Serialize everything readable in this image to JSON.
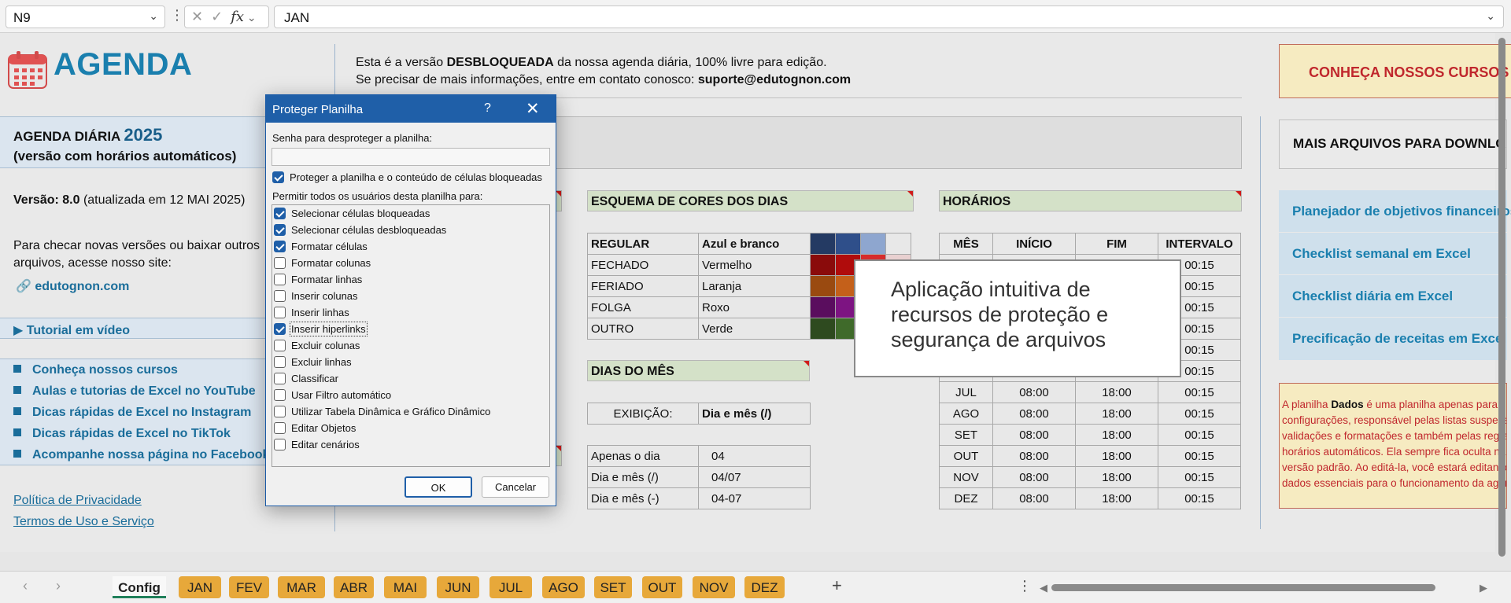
{
  "formula_bar": {
    "name_box": "N9",
    "formula": "JAN",
    "fx": "fx"
  },
  "header": {
    "title": "AGENDA",
    "info_line1_pre": "Esta é a versão ",
    "info_line1_bold": "DESBLOQUEADA",
    "info_line1_post": " da nossa agenda diária, 100% livre para edição.",
    "info_line2_pre": "Se precisar de mais informações, entre em contato conosco: ",
    "info_line2_email": "suporte@edutognon.com",
    "cursos_button": "CONHEÇA NOSSOS CURSOS"
  },
  "left_panel": {
    "title_line1": "AGENDA DIÁRIA",
    "year": "2025",
    "title_line2": "(versão com horários automáticos)",
    "versao_bold": "Versão: 8.0",
    "versao_rest": " (atualizada em 12 MAI 2025)",
    "checar": "Para checar novas versões ou baixar outros arquivos, acesse nosso site:",
    "site": "edutognon.com",
    "tutorial": "Tutorial em vídeo",
    "links": [
      "Conheça nossos cursos",
      "Aulas e tutorias de Excel no YouTube",
      "Dicas rápidas de Excel no Instagram",
      "Dicas rápidas de Excel no TikTok",
      "Acompanhe nossa página no Facebook"
    ],
    "privacy": "Política de Privacidade",
    "terms": "Termos de Uso e Serviço"
  },
  "cores": {
    "title": "ESQUEMA DE CORES DOS DIAS",
    "rows": [
      {
        "tipo": "REGULAR",
        "cor": "Azul e branco",
        "swatches": [
          "#243a63",
          "#2f4f8a",
          "#8ea6cf",
          "#e8e8e8"
        ]
      },
      {
        "tipo": "FECHADO",
        "cor": "Vermelho",
        "swatches": [
          "#8a0b0b",
          "#b00c0c",
          "#d62c2c",
          "#e8d0d0"
        ]
      },
      {
        "tipo": "FERIADO",
        "cor": "Laranja",
        "swatches": [
          "#9a4a10",
          "#c4601a",
          "#e28a3c",
          "#ecd8c4"
        ]
      },
      {
        "tipo": "FOLGA",
        "cor": "Roxo",
        "swatches": [
          "#5a0d5e",
          "#7d1482",
          "#a84aac",
          "#e2cfe3"
        ]
      },
      {
        "tipo": "OUTRO",
        "cor": "Verde",
        "swatches": [
          "#2e4a1f",
          "#3f6a2a",
          "#6f9a56",
          "#d6e4cc"
        ]
      }
    ]
  },
  "dias": {
    "title": "DIAS DO MÊS",
    "exibicao_label": "EXIBIÇÃO:",
    "exibicao_value": "Dia e mês (/)",
    "options": [
      {
        "label": "Apenas o dia",
        "example": "04"
      },
      {
        "label": "Dia e mês (/)",
        "example": "04/07"
      },
      {
        "label": "Dia e mês (-)",
        "example": "04-07"
      }
    ]
  },
  "horarios": {
    "title": "HORÁRIOS",
    "headers": [
      "MÊS",
      "INÍCIO",
      "FIM",
      "INTERVALO"
    ],
    "rows": [
      [
        "",
        "",
        "",
        "00:15"
      ],
      [
        "",
        "",
        "",
        "00:15"
      ],
      [
        "",
        "",
        "",
        "00:15"
      ],
      [
        "",
        "",
        "",
        "00:15"
      ],
      [
        "",
        "",
        "",
        "00:15"
      ],
      [
        "",
        "",
        "",
        "00:15"
      ],
      [
        "JUL",
        "08:00",
        "18:00",
        "00:15"
      ],
      [
        "AGO",
        "08:00",
        "18:00",
        "00:15"
      ],
      [
        "SET",
        "08:00",
        "18:00",
        "00:15"
      ],
      [
        "OUT",
        "08:00",
        "18:00",
        "00:15"
      ],
      [
        "NOV",
        "08:00",
        "18:00",
        "00:15"
      ],
      [
        "DEZ",
        "08:00",
        "18:00",
        "00:15"
      ]
    ]
  },
  "right_panel": {
    "head": "MAIS ARQUIVOS PARA DOWNLOAD",
    "links": [
      "Planejador de objetivos financeiros",
      "Checklist semanal em Excel",
      "Checklist diária em Excel",
      "Precificação de receitas em Excel"
    ],
    "note_lines": [
      "A planilha |Dados| é uma planilha apenas para",
      "configurações, responsável pelas listas suspensas,",
      "validações e formatações e também pelas regras dos",
      "horários automáticos. Ela sempre fica oculta na",
      "versão padrão. Ao editá-la, você estará editando",
      "dados essenciais para o funcionamento da agenda."
    ]
  },
  "callout": {
    "line1": "Aplicação intuitiva de",
    "line2": "recursos de proteção e",
    "line3": "segurança de arquivos"
  },
  "dialog": {
    "title": "Proteger Planilha",
    "help": "?",
    "close": "✕",
    "password_label": "Senha para desproteger a planilha:",
    "protect_label": "Proteger a planilha e o conteúdo de células bloqueadas",
    "allow_label": "Permitir todos os usuários desta planilha para:",
    "options": [
      {
        "label": "Selecionar células bloqueadas",
        "checked": true
      },
      {
        "label": "Selecionar células desbloqueadas",
        "checked": true
      },
      {
        "label": "Formatar células",
        "checked": true
      },
      {
        "label": "Formatar colunas",
        "checked": false
      },
      {
        "label": "Formatar linhas",
        "checked": false
      },
      {
        "label": "Inserir colunas",
        "checked": false
      },
      {
        "label": "Inserir linhas",
        "checked": false
      },
      {
        "label": "Inserir hiperlinks",
        "checked": true
      },
      {
        "label": "Excluir colunas",
        "checked": false
      },
      {
        "label": "Excluir linhas",
        "checked": false
      },
      {
        "label": "Classificar",
        "checked": false
      },
      {
        "label": "Usar Filtro automático",
        "checked": false
      },
      {
        "label": "Utilizar Tabela Dinâmica e Gráfico Dinâmico",
        "checked": false
      },
      {
        "label": "Editar Objetos",
        "checked": false
      },
      {
        "label": "Editar cenários",
        "checked": false
      }
    ],
    "ok": "OK",
    "cancel": "Cancelar"
  },
  "tabs": [
    "Config",
    "JAN",
    "FEV",
    "MAR",
    "ABR",
    "MAI",
    "JUN",
    "JUL",
    "AGO",
    "SET",
    "OUT",
    "NOV",
    "DEZ"
  ],
  "active_tab": "Config",
  "colors": {
    "accent": "#1a7fae",
    "tab": "#e7a83a",
    "dialog": "#1f5fa8"
  }
}
